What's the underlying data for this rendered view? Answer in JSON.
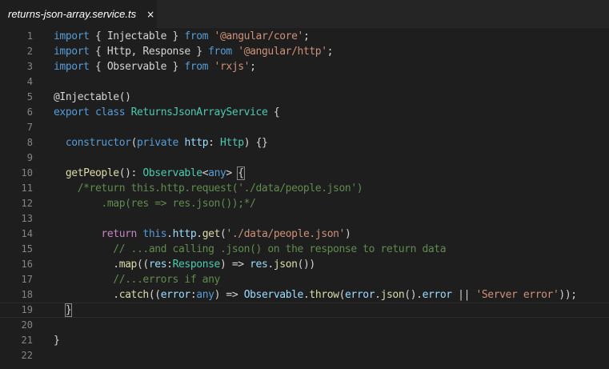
{
  "tab": {
    "title": "returns-json-array.service.ts",
    "close_icon": "×"
  },
  "lines": [
    {
      "n": "1",
      "tokens": [
        [
          "kw",
          "import"
        ],
        [
          "p",
          " { Injectable } "
        ],
        [
          "kw",
          "from"
        ],
        [
          "p",
          " "
        ],
        [
          "str",
          "'@angular/core'"
        ],
        [
          "p",
          ";"
        ]
      ]
    },
    {
      "n": "2",
      "tokens": [
        [
          "kw",
          "import"
        ],
        [
          "p",
          " { Http, Response } "
        ],
        [
          "kw",
          "from"
        ],
        [
          "p",
          " "
        ],
        [
          "str",
          "'@angular/http'"
        ],
        [
          "p",
          ";"
        ]
      ]
    },
    {
      "n": "3",
      "tokens": [
        [
          "kw",
          "import"
        ],
        [
          "p",
          " { Observable } "
        ],
        [
          "kw",
          "from"
        ],
        [
          "p",
          " "
        ],
        [
          "str",
          "'rxjs'"
        ],
        [
          "p",
          ";"
        ]
      ]
    },
    {
      "n": "4",
      "tokens": []
    },
    {
      "n": "5",
      "tokens": [
        [
          "p",
          "@Injectable()"
        ]
      ]
    },
    {
      "n": "6",
      "tokens": [
        [
          "kw",
          "export"
        ],
        [
          "p",
          " "
        ],
        [
          "kw",
          "class"
        ],
        [
          "p",
          " "
        ],
        [
          "cls",
          "ReturnsJsonArrayService"
        ],
        [
          "p",
          " {"
        ]
      ]
    },
    {
      "n": "7",
      "tokens": []
    },
    {
      "n": "8",
      "tokens": [
        [
          "p",
          "  "
        ],
        [
          "kw",
          "constructor"
        ],
        [
          "p",
          "("
        ],
        [
          "kw",
          "private"
        ],
        [
          "p",
          " "
        ],
        [
          "var",
          "http"
        ],
        [
          "p",
          ": "
        ],
        [
          "cls",
          "Http"
        ],
        [
          "p",
          ") {}"
        ]
      ]
    },
    {
      "n": "9",
      "tokens": []
    },
    {
      "n": "10",
      "tokens": [
        [
          "p",
          "  "
        ],
        [
          "fn",
          "getPeople"
        ],
        [
          "p",
          "(): "
        ],
        [
          "cls",
          "Observable"
        ],
        [
          "p",
          "<"
        ],
        [
          "kw",
          "any"
        ],
        [
          "p",
          "> "
        ],
        [
          "br",
          "{"
        ]
      ]
    },
    {
      "n": "11",
      "tokens": [
        [
          "cm",
          "    /*return this.http.request('./data/people.json')"
        ]
      ]
    },
    {
      "n": "12",
      "tokens": [
        [
          "cm",
          "        .map(res => res.json());*/"
        ]
      ]
    },
    {
      "n": "13",
      "tokens": []
    },
    {
      "n": "14",
      "tokens": [
        [
          "p",
          "        "
        ],
        [
          "ctl",
          "return"
        ],
        [
          "p",
          " "
        ],
        [
          "kw",
          "this"
        ],
        [
          "p",
          "."
        ],
        [
          "var",
          "http"
        ],
        [
          "p",
          "."
        ],
        [
          "fn",
          "get"
        ],
        [
          "p",
          "("
        ],
        [
          "str",
          "'./data/people.json'"
        ],
        [
          "p",
          ")"
        ]
      ]
    },
    {
      "n": "15",
      "tokens": [
        [
          "cm",
          "          // ...and calling .json() on the response to return data"
        ]
      ]
    },
    {
      "n": "16",
      "tokens": [
        [
          "p",
          "          ."
        ],
        [
          "fn",
          "map"
        ],
        [
          "p",
          "(("
        ],
        [
          "var",
          "res"
        ],
        [
          "p",
          ":"
        ],
        [
          "cls",
          "Response"
        ],
        [
          "p",
          ") => "
        ],
        [
          "var",
          "res"
        ],
        [
          "p",
          "."
        ],
        [
          "fn",
          "json"
        ],
        [
          "p",
          "())"
        ]
      ]
    },
    {
      "n": "17",
      "tokens": [
        [
          "cm",
          "          //...errors if any"
        ]
      ]
    },
    {
      "n": "18",
      "tokens": [
        [
          "p",
          "          ."
        ],
        [
          "fn",
          "catch"
        ],
        [
          "p",
          "(("
        ],
        [
          "var",
          "error"
        ],
        [
          "p",
          ":"
        ],
        [
          "kw",
          "any"
        ],
        [
          "p",
          ") => "
        ],
        [
          "var",
          "Observable"
        ],
        [
          "p",
          "."
        ],
        [
          "fn",
          "throw"
        ],
        [
          "p",
          "("
        ],
        [
          "var",
          "error"
        ],
        [
          "p",
          "."
        ],
        [
          "fn",
          "json"
        ],
        [
          "p",
          "()."
        ],
        [
          "var",
          "error"
        ],
        [
          "p",
          " || "
        ],
        [
          "str",
          "'Server error'"
        ],
        [
          "p",
          "));"
        ]
      ]
    },
    {
      "n": "19",
      "tokens": [
        [
          "p",
          "  "
        ],
        [
          "br",
          "}"
        ]
      ],
      "current": true
    },
    {
      "n": "20",
      "tokens": []
    },
    {
      "n": "21",
      "tokens": [
        [
          "p",
          "}"
        ]
      ]
    },
    {
      "n": "22",
      "tokens": []
    }
  ],
  "colors": {
    "background": "#1e1e1e",
    "keyword": "#569cd6",
    "string": "#ce9178",
    "comment": "#608b4e",
    "class": "#4ec9b0",
    "function": "#dcdcaa",
    "variable": "#9cdcfe",
    "line_number": "#858585"
  }
}
